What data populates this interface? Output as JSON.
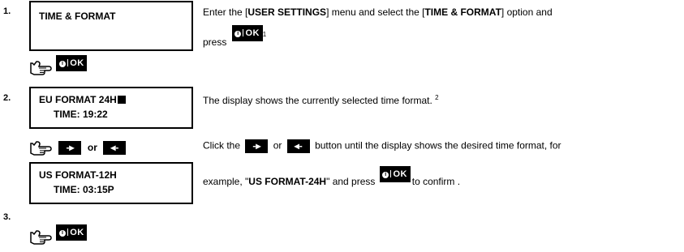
{
  "steps": [
    {
      "number": "1.",
      "display": [
        "TIME & FORMAT"
      ],
      "description": {
        "part1": "Enter the [",
        "bold1": "USER SETTINGS",
        "part2": "] menu and select the [",
        "bold2": "TIME & FORMAT",
        "part3": "] option and",
        "part4": "press",
        "footnote": "1"
      }
    },
    {
      "number": "2.",
      "display": [
        "EU FORMAT 24H",
        "TIME: 19:22"
      ],
      "description": {
        "text": "The display shows the currently selected time format.",
        "footnote": "2"
      },
      "click_text": {
        "a": "Click the",
        "or": "or",
        "b": "button until the display shows the desired time format, for",
        "c_pre": "example, \"",
        "c_bold": "US FORMAT-24H",
        "c_post": "\" and press",
        "c_end": "to confirm ."
      },
      "display2": [
        "US FORMAT-12H",
        "TIME: 03:15P"
      ]
    },
    {
      "number": "3."
    }
  ],
  "keys": {
    "ok": "OK",
    "info": "i",
    "right_arrow": "-▸",
    "left_arrow": "◂-",
    "or": "or"
  }
}
